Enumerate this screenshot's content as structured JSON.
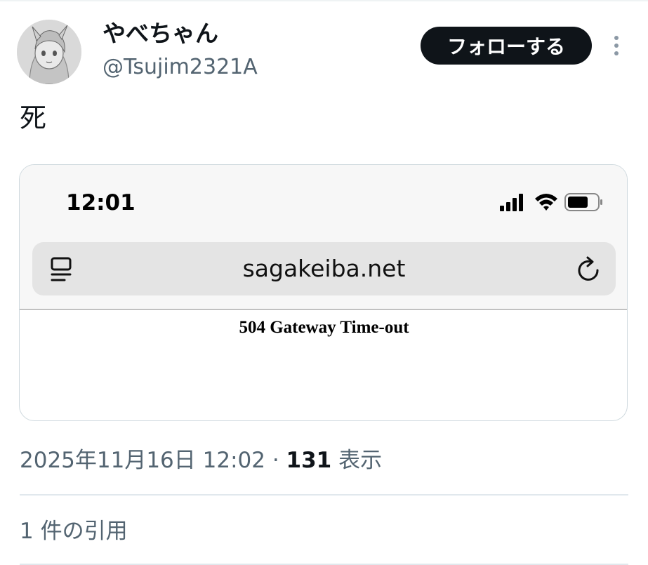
{
  "user": {
    "display_name": "やべちゃん",
    "handle": "@Tsujim2321A",
    "avatar_icon": "avatar-sketch-icon"
  },
  "actions": {
    "follow_label": "フォローする",
    "more_icon": "more-vertical-icon"
  },
  "tweet": {
    "text": "死"
  },
  "screenshot": {
    "time": "12:01",
    "status_icons": [
      "signal-icon",
      "wifi-icon",
      "battery-icon"
    ],
    "url": "sagakeiba.net",
    "reader_icon": "reader-mode-icon",
    "reload_icon": "reload-icon",
    "error_message": "504 Gateway Time-out"
  },
  "meta": {
    "timestamp": "2025年11月16日 12:02",
    "separator": " · ",
    "views_count": "131",
    "views_label": " 表示"
  },
  "quotes": {
    "label": "1 件の引用"
  },
  "colors": {
    "text_primary": "#0f1419",
    "text_secondary": "#536471",
    "follow_bg": "#0f1419",
    "border": "#cfd9de"
  }
}
